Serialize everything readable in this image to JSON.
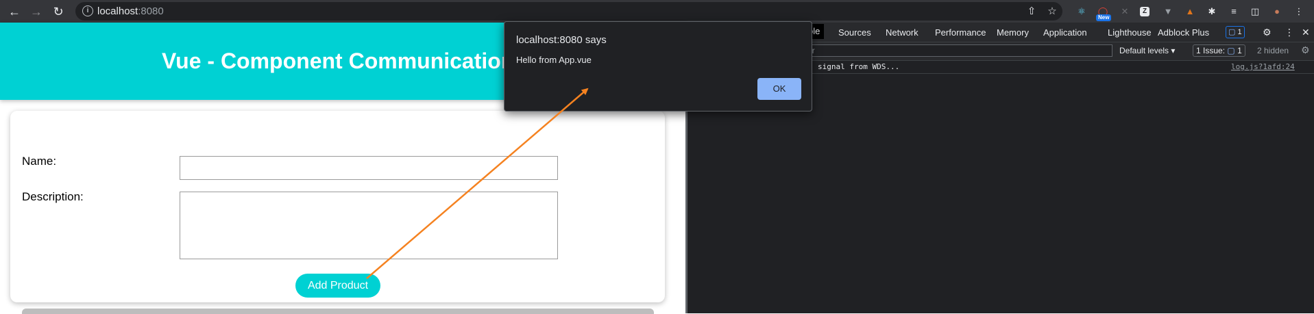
{
  "browser": {
    "url_host": "localhost",
    "url_port": ":8080",
    "new_badge": "New"
  },
  "page": {
    "title": "Vue - Component Communication",
    "name_label": "Name:",
    "name_value": "",
    "description_label": "Description:",
    "description_value": "",
    "add_button": "Add Product",
    "colors": {
      "accent": "#00d1d3"
    }
  },
  "devtools": {
    "tabs": [
      "ole",
      "Sources",
      "Network",
      "Performance",
      "Memory",
      "Application",
      "Lighthouse",
      "Adblock Plus"
    ],
    "messages_badge": "1",
    "filter_placeholder": "er",
    "default_levels": "Default levels",
    "issues_label": "1 Issue:",
    "issues_count": "1",
    "hidden_label": "2 hidden",
    "console": [
      {
        "message": "signal from WDS...",
        "source": "log.js?1afd:24"
      }
    ]
  },
  "dialog": {
    "title": "localhost:8080 says",
    "message": "Hello from App.vue",
    "ok_label": "OK"
  },
  "annotation": {
    "color": "#f58220"
  }
}
